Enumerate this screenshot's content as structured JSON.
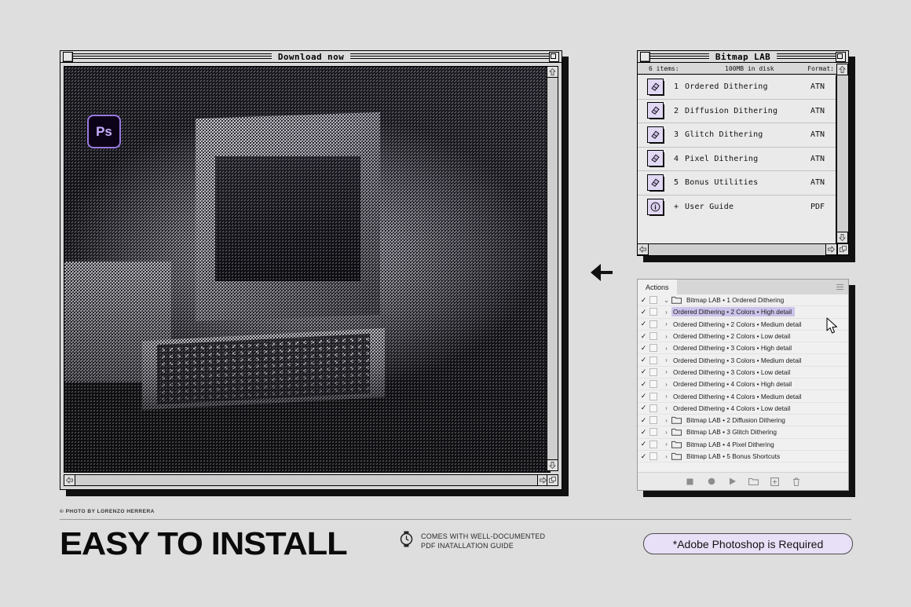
{
  "page": {
    "background": "#dedede",
    "accent": "#cbc0ea"
  },
  "main_window": {
    "title": "Download now",
    "photoshop_badge": "Ps",
    "close_icon": "close-box-icon",
    "zoom_icon": "zoom-box-icon",
    "scroll_up_icon": "▲",
    "scroll_down_icon": "▼",
    "scroll_left_icon": "◀",
    "resize_icon": "resize-grip-icon"
  },
  "finder_window": {
    "title": "Bitmap LAB",
    "info": {
      "items": "6 items:",
      "disk": "100MB in disk",
      "format": "Format:"
    },
    "files": [
      {
        "num": "1",
        "name": "Ordered Dithering",
        "ext": "ATN",
        "icon": "action-file-icon"
      },
      {
        "num": "2",
        "name": "Diffusion Dithering",
        "ext": "ATN",
        "icon": "action-file-icon"
      },
      {
        "num": "3",
        "name": "Glitch Dithering",
        "ext": "ATN",
        "icon": "action-file-icon"
      },
      {
        "num": "4",
        "name": "Pixel Dithering",
        "ext": "ATN",
        "icon": "action-file-icon"
      },
      {
        "num": "5",
        "name": "Bonus Utilities",
        "ext": "ATN",
        "icon": "action-file-icon"
      },
      {
        "num": "+",
        "name": "User Guide",
        "ext": "PDF",
        "icon": "pdf-info-icon"
      }
    ]
  },
  "actions_panel": {
    "tab_label": "Actions",
    "menu_icon": "panel-menu-icon",
    "check_glyph": "✓",
    "twirl_open": "⌄",
    "twirl_closed": "›",
    "rows": [
      {
        "label": "Bitmap LAB • 1 Ordered Dithering",
        "type": "set",
        "open": true,
        "selected": false
      },
      {
        "label": "Ordered Dithering • 2 Colors • High detail",
        "type": "action",
        "open": false,
        "selected": true
      },
      {
        "label": "Ordered Dithering • 2 Colors • Medium detail",
        "type": "action",
        "open": false,
        "selected": false
      },
      {
        "label": "Ordered Dithering • 2 Colors • Low detail",
        "type": "action",
        "open": false,
        "selected": false
      },
      {
        "label": "Ordered Dithering • 3 Colors • High detail",
        "type": "action",
        "open": false,
        "selected": false
      },
      {
        "label": "Ordered Dithering • 3 Colors • Medium detail",
        "type": "action",
        "open": false,
        "selected": false
      },
      {
        "label": "Ordered Dithering • 3 Colors • Low detail",
        "type": "action",
        "open": false,
        "selected": false
      },
      {
        "label": "Ordered Dithering • 4 Colors • High detail",
        "type": "action",
        "open": false,
        "selected": false
      },
      {
        "label": "Ordered Dithering • 4 Colors • Medium detail",
        "type": "action",
        "open": false,
        "selected": false
      },
      {
        "label": "Ordered Dithering • 4 Colors • Low detail",
        "type": "action",
        "open": false,
        "selected": false
      },
      {
        "label": "Bitmap LAB • 2 Diffusion Dithering",
        "type": "set",
        "open": false,
        "selected": false
      },
      {
        "label": "Bitmap LAB • 3 Glitch Dithering",
        "type": "set",
        "open": false,
        "selected": false
      },
      {
        "label": "Bitmap LAB • 4 Pixel Dithering",
        "type": "set",
        "open": false,
        "selected": false
      },
      {
        "label": "Bitmap LAB • 5 Bonus Shortcuts",
        "type": "set",
        "open": false,
        "selected": false
      }
    ],
    "footer_icons": [
      "stop-icon",
      "record-icon",
      "play-icon",
      "new-set-folder-icon",
      "new-action-icon",
      "delete-trash-icon"
    ],
    "selection_color": "#ccc3ea"
  },
  "middle_arrow_icon": "arrow-left-icon",
  "footer": {
    "credit": "© PHOTO BY LORENZO HERRERA",
    "headline": "EASY TO INSTALL",
    "feature_icon": "watch-icon",
    "feature_line1": "COMES WITH WELL-DOCUMENTED",
    "feature_line2": "PDF INATALLATION GUIDE",
    "pill_label": "*Adobe Photoshop is Required"
  }
}
